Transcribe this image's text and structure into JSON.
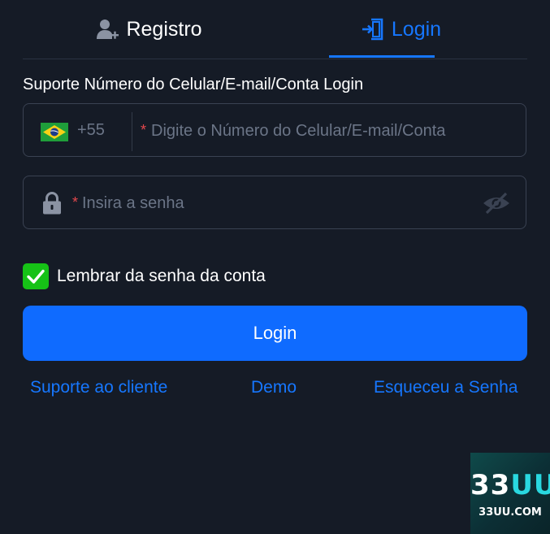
{
  "tabs": {
    "register_label": "Registro",
    "login_label": "Login",
    "active": "login"
  },
  "form": {
    "support_label": "Suporte Número do Celular/E-mail/Conta Login",
    "country_code": "+55",
    "phone_required_mark": "*",
    "phone_placeholder": "Digite o Número do Celular/E-mail/Conta",
    "password_required_mark": "*",
    "password_placeholder": "Insira a senha",
    "remember_label": "Lembrar da senha da conta",
    "remember_checked": true,
    "login_button_label": "Login"
  },
  "links": {
    "support": "Suporte ao cliente",
    "demo": "Demo",
    "forgot": "Esqueceu a Senha"
  },
  "logo": {
    "main_prefix": "33",
    "main_accent": "UU",
    "sub": "33UU.COM"
  },
  "colors": {
    "background": "#151b26",
    "accent": "#1677ff",
    "button": "#0f6bff",
    "checkbox": "#16c216",
    "required": "#e5484d"
  },
  "icons": {
    "register_tab": "user-plus-icon",
    "login_tab": "login-door-icon",
    "country": "brazil-flag-icon",
    "password": "lock-icon",
    "visibility": "eye-off-icon",
    "checkbox": "checkmark-icon"
  }
}
